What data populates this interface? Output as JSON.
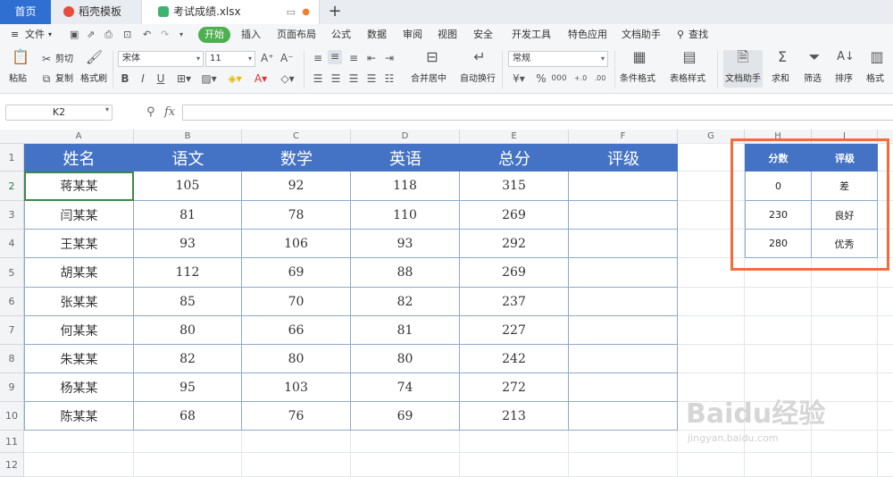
{
  "tabs": {
    "home": "首页",
    "docer": "稻壳模板",
    "file": "考试成绩.xlsx"
  },
  "menu": {
    "file": "文件",
    "items": [
      "开始",
      "插入",
      "页面布局",
      "公式",
      "数据",
      "审阅",
      "视图",
      "安全",
      "开发工具",
      "特色应用",
      "文档助手"
    ],
    "search": "查找"
  },
  "ribbon": {
    "paste": "粘贴",
    "cut": "剪切",
    "copy": "复制",
    "format_painter": "格式刷",
    "font_name": "宋体",
    "font_size": "11",
    "number_format": "常规",
    "merge_center": "合并居中",
    "wrap_text": "自动换行",
    "conditional_format": "条件格式",
    "table_style": "表格样式",
    "doc_helper": "文档助手",
    "sum": "求和",
    "filter": "筛选",
    "sort": "排序",
    "format": "格式"
  },
  "formula_bar": {
    "cell_ref": "K2",
    "fx": "fx",
    "content": ""
  },
  "columns": [
    "A",
    "B",
    "C",
    "D",
    "E",
    "F",
    "G",
    "H",
    "I"
  ],
  "rows": [
    "1",
    "2",
    "3",
    "4",
    "5",
    "6",
    "7",
    "8",
    "9",
    "10",
    "11",
    "12"
  ],
  "table": {
    "headers": [
      "姓名",
      "语文",
      "数学",
      "英语",
      "总分",
      "评级"
    ],
    "rows": [
      [
        "蒋某某",
        "105",
        "92",
        "118",
        "315",
        ""
      ],
      [
        "闫某某",
        "81",
        "78",
        "110",
        "269",
        ""
      ],
      [
        "王某某",
        "93",
        "106",
        "93",
        "292",
        ""
      ],
      [
        "胡某某",
        "112",
        "69",
        "88",
        "269",
        ""
      ],
      [
        "张某某",
        "85",
        "70",
        "82",
        "237",
        ""
      ],
      [
        "何某某",
        "80",
        "66",
        "81",
        "227",
        ""
      ],
      [
        "朱某某",
        "82",
        "80",
        "80",
        "242",
        ""
      ],
      [
        "杨某某",
        "95",
        "103",
        "74",
        "272",
        ""
      ],
      [
        "陈某某",
        "68",
        "76",
        "69",
        "213",
        ""
      ]
    ]
  },
  "lookup": {
    "headers": [
      "分数",
      "评级"
    ],
    "rows": [
      [
        "0",
        "差"
      ],
      [
        "230",
        "良好"
      ],
      [
        "280",
        "优秀"
      ]
    ]
  },
  "watermark": {
    "logo": "Baidu经验",
    "url": "jingyan.baidu.com"
  },
  "colors": {
    "header_blue": "#4472c4",
    "highlight_orange": "#f26d3d",
    "tab_blue": "#2f6fd1",
    "start_green": "#4caf50"
  }
}
